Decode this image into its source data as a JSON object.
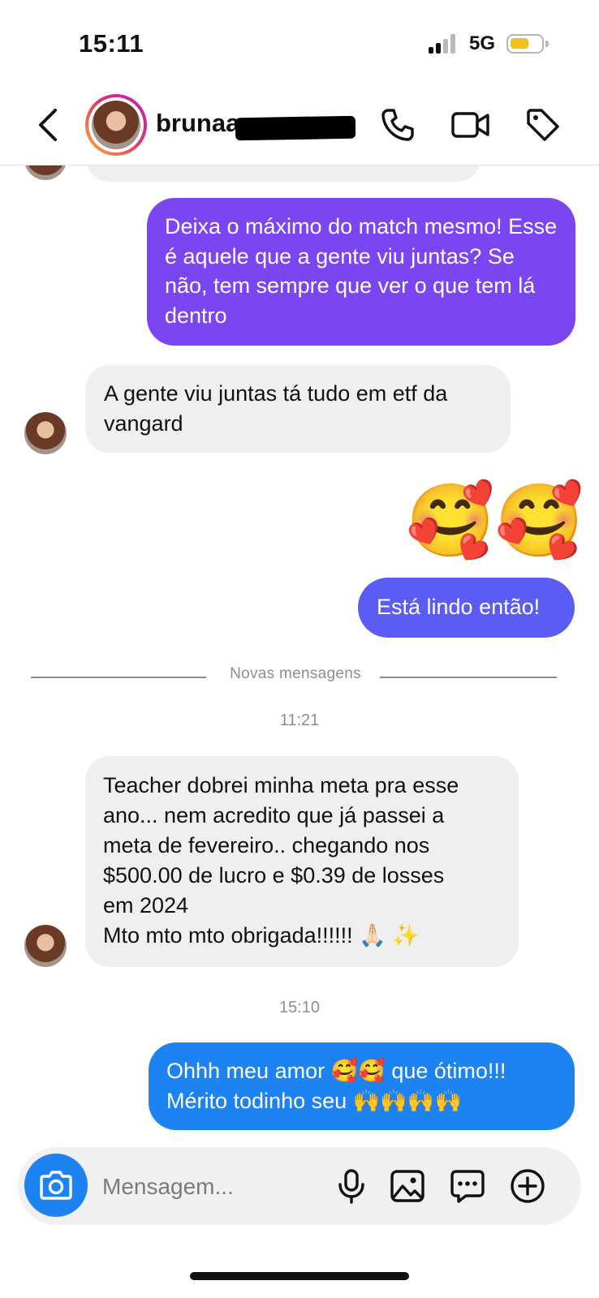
{
  "status_bar": {
    "time": "15:11",
    "network": "5G"
  },
  "header": {
    "username": "brunaa_"
  },
  "messages": [
    {
      "type": "outgoing",
      "text": "Deixa o máximo do match mesmo! Esse é aquele que a gente viu juntas? Se não, tem sempre que ver o que tem lá dentro"
    },
    {
      "type": "incoming",
      "text": "A gente viu juntas tá tudo em etf da vangard"
    },
    {
      "type": "outgoing_emoji",
      "text": "🥰🥰"
    },
    {
      "type": "outgoing",
      "text": "Está lindo então!"
    },
    {
      "type": "incoming",
      "lines": [
        "Teacher dobrei minha meta pra esse",
        "ano... nem acredito que já passei a",
        "meta de fevereiro.. chegando nos",
        "$500.00 de lucro e $0.39 de losses",
        "em 2024",
        "Mto mto mto obrigada!!!!!! 🙏🏻 ✨"
      ]
    },
    {
      "type": "outgoing",
      "lines": [
        "Ohhh meu amor 🥰🥰 que ótimo!!!",
        "Mérito todinho seu 🙌🙌🙌🙌"
      ]
    }
  ],
  "divider": {
    "label": "Novas mensagens"
  },
  "timestamps": [
    "11:21",
    "15:10"
  ],
  "composer": {
    "placeholder": "Mensagem..."
  },
  "colors": {
    "purple_bubble": "#7c45f2",
    "indigo_bubble": "#5b5cf3",
    "blue_bubble": "#1d83f3",
    "incoming_bubble": "#efefef"
  }
}
